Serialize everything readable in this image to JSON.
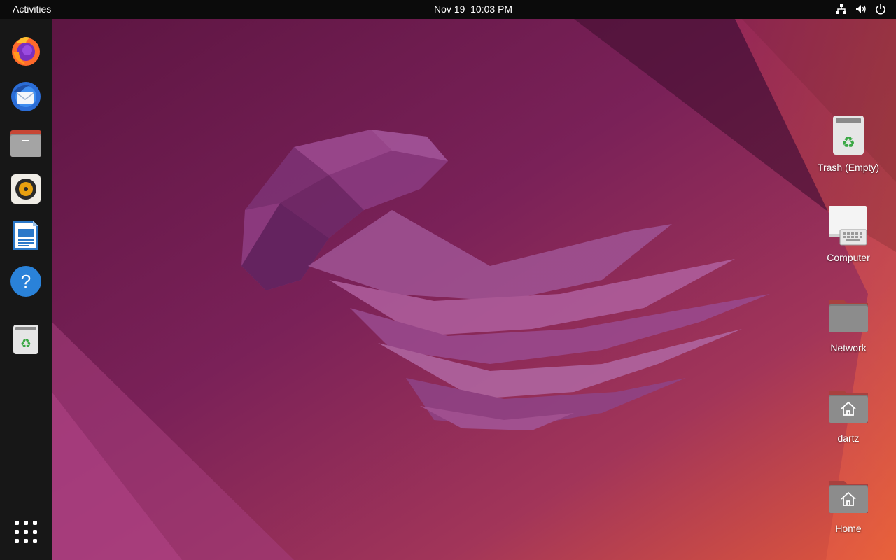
{
  "topbar": {
    "activities_label": "Activities",
    "date": "Nov 19",
    "time": "10:03 PM",
    "tray_icons": [
      "network-icon",
      "volume-icon",
      "power-icon"
    ]
  },
  "dock": {
    "apps": [
      {
        "name": "firefox-icon"
      },
      {
        "name": "thunderbird-icon"
      },
      {
        "name": "files-icon"
      },
      {
        "name": "rhythmbox-icon"
      },
      {
        "name": "libreoffice-writer-icon"
      },
      {
        "name": "help-icon"
      },
      {
        "name": "trash-icon"
      }
    ],
    "show_apps_icon": "app-grid-icon"
  },
  "desktop_icons": [
    {
      "label": "Trash (Empty)",
      "icon": "trash-icon"
    },
    {
      "label": "Computer",
      "icon": "computer-icon"
    },
    {
      "label": "Network",
      "icon": "folder-icon"
    },
    {
      "label": "dartz",
      "icon": "home-folder-icon"
    },
    {
      "label": "Home",
      "icon": "home-folder-icon"
    }
  ],
  "colors": {
    "topbar_bg": "#0b0b0b",
    "dock_bg": "#171717",
    "wallpaper_primary": "#6b1f55",
    "wallpaper_accent": "#e0573a"
  }
}
